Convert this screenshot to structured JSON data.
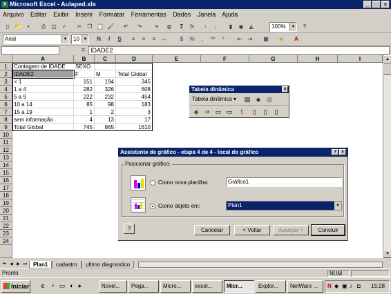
{
  "title": "Microsoft Excel - Aulaped.xls",
  "menu": [
    "Arquivo",
    "Editar",
    "Exibir",
    "Inserir",
    "Formatar",
    "Ferramentas",
    "Dados",
    "Janela",
    "Ajuda"
  ],
  "toolbar": {
    "zoom": "100%",
    "font": "Arial",
    "size": "10",
    "bold": "N",
    "italic": "I",
    "underline": "S"
  },
  "formula": {
    "content": "IDADE2",
    "fx": "="
  },
  "columns": [
    "A",
    "B",
    "C",
    "D",
    "E",
    "F",
    "G",
    "H",
    "I"
  ],
  "rows": [
    "1",
    "2",
    "3",
    "4",
    "5",
    "6",
    "7",
    "8",
    "9",
    "10",
    "11",
    "12",
    "13",
    "14",
    "15",
    "16",
    "17",
    "18",
    "19",
    "20",
    "21",
    "22",
    "23",
    "24"
  ],
  "cells": {
    "r1": [
      "Contagem de IDADE",
      "SEXO",
      "",
      ""
    ],
    "r2": [
      "IDADE2",
      "F",
      "M",
      "Total Global"
    ],
    "r3": [
      "< 1",
      "151",
      "194",
      "345"
    ],
    "r4": [
      "1 a 4",
      "282",
      "326",
      "608"
    ],
    "r5": [
      "5 a 9",
      "222",
      "232",
      "454"
    ],
    "r6": [
      "10 a 14",
      "85",
      "98",
      "183"
    ],
    "r7": [
      "15 a 19",
      "1",
      "2",
      "3"
    ],
    "r8": [
      "sem informação",
      "4",
      "13",
      "17"
    ],
    "r9": [
      "Total Global",
      "745",
      "865",
      "1610"
    ]
  },
  "pivot": {
    "title": "Tabela dinâmica",
    "menu": "Tabela dinâmica ▾"
  },
  "dialog": {
    "title": "Assistente de gráfico - etapa 4 de 4 - local do gráfico",
    "group": "Posicionar gráfico:",
    "opt1": "Como nova planilha:",
    "opt1_value": "Gráfico1",
    "opt2": "Como objeto em:",
    "opt2_value": "Plan1",
    "help": "?",
    "cancel": "Cancelar",
    "back": "< Voltar",
    "next": "Avançar >",
    "finish": "Concluir"
  },
  "tabs": [
    "Plan1",
    "cadastro",
    "ultimo diagnostico"
  ],
  "status": {
    "left": "Pronto",
    "num": "NUM"
  },
  "taskbar": {
    "start": "Iniciar",
    "items": [
      "Novel...",
      "Pega...",
      "Micro...",
      "excel...",
      "Micr...",
      "Explor...",
      "NetWare ..."
    ],
    "clock": "15:28"
  }
}
